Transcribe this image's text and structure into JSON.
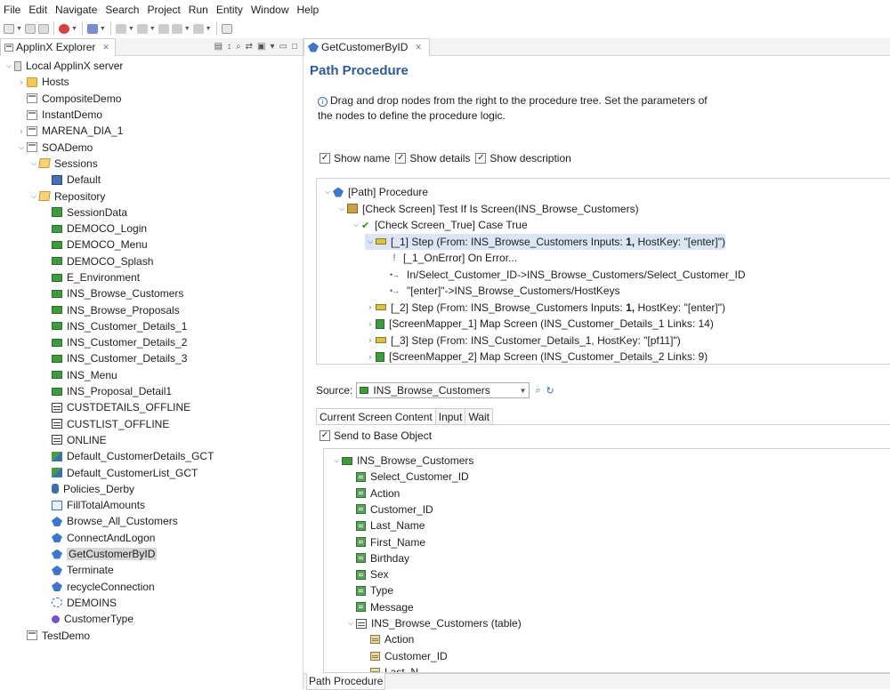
{
  "menu": [
    "File",
    "Edit",
    "Navigate",
    "Search",
    "Project",
    "Run",
    "Entity",
    "Window",
    "Help"
  ],
  "explorer": {
    "tab_label": "ApplinX Explorer",
    "tab_close": "✕",
    "tree": [
      {
        "label": "Local ApplinX server",
        "icon": "server-icon",
        "depth": 0,
        "twisty": "open"
      },
      {
        "label": "Hosts",
        "icon": "folder-icon",
        "depth": 1,
        "twisty": "closed"
      },
      {
        "label": "CompositeDemo",
        "icon": "application-icon",
        "depth": 1,
        "twisty": ""
      },
      {
        "label": "InstantDemo",
        "icon": "application-icon",
        "depth": 1,
        "twisty": ""
      },
      {
        "label": "MARENA_DIA_1",
        "icon": "application-icon",
        "depth": 1,
        "twisty": "closed"
      },
      {
        "label": "SOADemo",
        "icon": "application-icon",
        "depth": 1,
        "twisty": "open"
      },
      {
        "label": "Sessions",
        "icon": "open-folder-icon",
        "depth": 2,
        "twisty": "open"
      },
      {
        "label": "Default",
        "icon": "session-icon",
        "depth": 3,
        "twisty": ""
      },
      {
        "label": "Repository",
        "icon": "open-folder-icon",
        "depth": 2,
        "twisty": "open"
      },
      {
        "label": "SessionData",
        "icon": "session-data-icon",
        "depth": 3,
        "twisty": ""
      },
      {
        "label": "DEMOCO_Login",
        "icon": "screen-icon",
        "depth": 3,
        "twisty": ""
      },
      {
        "label": "DEMOCO_Menu",
        "icon": "screen-icon",
        "depth": 3,
        "twisty": ""
      },
      {
        "label": "DEMOCO_Splash",
        "icon": "screen-icon",
        "depth": 3,
        "twisty": ""
      },
      {
        "label": "E_Environment",
        "icon": "screen-icon",
        "depth": 3,
        "twisty": ""
      },
      {
        "label": "INS_Browse_Customers",
        "icon": "screen-icon",
        "depth": 3,
        "twisty": ""
      },
      {
        "label": "INS_Browse_Proposals",
        "icon": "screen-icon",
        "depth": 3,
        "twisty": ""
      },
      {
        "label": "INS_Customer_Details_1",
        "icon": "screen-icon",
        "depth": 3,
        "twisty": ""
      },
      {
        "label": "INS_Customer_Details_2",
        "icon": "screen-icon",
        "depth": 3,
        "twisty": ""
      },
      {
        "label": "INS_Customer_Details_3",
        "icon": "screen-icon",
        "depth": 3,
        "twisty": ""
      },
      {
        "label": "INS_Menu",
        "icon": "screen-icon",
        "depth": 3,
        "twisty": ""
      },
      {
        "label": "INS_Proposal_Detail1",
        "icon": "screen-icon",
        "depth": 3,
        "twisty": ""
      },
      {
        "label": "CUSTDETAILS_OFFLINE",
        "icon": "table-icon",
        "depth": 3,
        "twisty": ""
      },
      {
        "label": "CUSTLIST_OFFLINE",
        "icon": "table-icon",
        "depth": 3,
        "twisty": ""
      },
      {
        "label": "ONLINE",
        "icon": "table-icon",
        "depth": 3,
        "twisty": ""
      },
      {
        "label": "Default_CustomerDetails_GCT",
        "icon": "gct-icon",
        "depth": 3,
        "twisty": ""
      },
      {
        "label": "Default_CustomerList_GCT",
        "icon": "gct-icon",
        "depth": 3,
        "twisty": ""
      },
      {
        "label": "Policies_Derby",
        "icon": "database-icon",
        "depth": 3,
        "twisty": ""
      },
      {
        "label": "FillTotalAmounts",
        "icon": "flow-icon",
        "depth": 3,
        "twisty": ""
      },
      {
        "label": "Browse_All_Customers",
        "icon": "path-procedure-icon",
        "depth": 3,
        "twisty": ""
      },
      {
        "label": "ConnectAndLogon",
        "icon": "path-procedure-icon",
        "depth": 3,
        "twisty": ""
      },
      {
        "label": "GetCustomerByID",
        "icon": "path-procedure-icon",
        "depth": 3,
        "twisty": "",
        "selected": true
      },
      {
        "label": "Terminate",
        "icon": "path-procedure-icon",
        "depth": 3,
        "twisty": ""
      },
      {
        "label": "recycleConnection",
        "icon": "path-procedure-icon",
        "depth": 3,
        "twisty": ""
      },
      {
        "label": "DEMOINS",
        "icon": "demoins-icon",
        "depth": 3,
        "twisty": ""
      },
      {
        "label": "CustomerType",
        "icon": "type-icon",
        "depth": 3,
        "twisty": ""
      },
      {
        "label": "TestDemo",
        "icon": "application-icon",
        "depth": 1,
        "twisty": ""
      }
    ]
  },
  "editor": {
    "tab_label": "GetCustomerByID",
    "tab_close": "✕",
    "title": "Path Procedure",
    "info_line1": "Drag and drop nodes from the right to the procedure tree. Set the parameters of",
    "info_line2": "the nodes to define the procedure logic.",
    "show_name": "Show name",
    "show_details": "Show details",
    "show_description": "Show description",
    "procedure_tree": [
      {
        "label": "[Path] Procedure",
        "icon": "path-icon",
        "twisty": "open",
        "depth": 0
      },
      {
        "label": "[Check Screen] Test If Is Screen(INS_Browse_Customers)",
        "icon": "check-screen-icon",
        "twisty": "open",
        "depth": 1
      },
      {
        "label": "[Check Screen_True] Case True",
        "icon": "case-true-icon",
        "twisty": "open",
        "depth": 2
      },
      {
        "label_pre": "[_1] Step (From: INS_Browse_Customers Inputs: ",
        "label_bold": "1,",
        "label_post": " HostKey: \"[enter]\")",
        "icon": "step-icon",
        "twisty": "open",
        "depth": 3,
        "highlight": true
      },
      {
        "label": "[_1_OnError] On Error...",
        "icon": "error-icon",
        "twisty": "",
        "depth": 4
      },
      {
        "label": "In/Select_Customer_ID->INS_Browse_Customers/Select_Customer_ID",
        "icon": "link-icon",
        "twisty": "",
        "depth": 4
      },
      {
        "label": "\"[enter]\"->INS_Browse_Customers/HostKeys",
        "icon": "link-icon",
        "twisty": "",
        "depth": 4
      },
      {
        "label_pre": "[_2] Step (From: INS_Browse_Customers Inputs: ",
        "label_bold": "1,",
        "label_post": " HostKey: \"[enter]\")",
        "icon": "step-icon",
        "twisty": "closed",
        "depth": 3
      },
      {
        "label": "[ScreenMapper_1] Map Screen (INS_Customer_Details_1 Links: 14)",
        "icon": "map-screen-icon",
        "twisty": "closed",
        "depth": 3
      },
      {
        "label": "[_3] Step (From: INS_Customer_Details_1, HostKey: \"[pf11]\")",
        "icon": "step-icon",
        "twisty": "closed",
        "depth": 3
      },
      {
        "label": "[ScreenMapper_2] Map Screen (INS_Customer_Details_2 Links: 9)",
        "icon": "map-screen-icon",
        "twisty": "closed",
        "depth": 3
      }
    ],
    "source_label": "Source:",
    "source_value": "INS_Browse_Customers",
    "subtabs": [
      "Current Screen Content",
      "Input",
      "Wait"
    ],
    "send_to_base": "Send to Base Object",
    "screen_tree": [
      {
        "label": "INS_Browse_Customers",
        "icon": "screen-icon",
        "twisty": "open",
        "depth": 0
      },
      {
        "label": "Select_Customer_ID",
        "icon": "field-icon",
        "twisty": "",
        "depth": 1
      },
      {
        "label": "Action",
        "icon": "field-icon",
        "twisty": "",
        "depth": 1
      },
      {
        "label": "Customer_ID",
        "icon": "field-icon",
        "twisty": "",
        "depth": 1
      },
      {
        "label": "Last_Name",
        "icon": "field-icon",
        "twisty": "",
        "depth": 1
      },
      {
        "label": "First_Name",
        "icon": "field-icon",
        "twisty": "",
        "depth": 1
      },
      {
        "label": "Birthday",
        "icon": "field-icon",
        "twisty": "",
        "depth": 1
      },
      {
        "label": "Sex",
        "icon": "field-icon",
        "twisty": "",
        "depth": 1
      },
      {
        "label": "Type",
        "icon": "field-icon",
        "twisty": "",
        "depth": 1
      },
      {
        "label": "Message",
        "icon": "field-icon",
        "twisty": "",
        "depth": 1
      },
      {
        "label": "INS_Browse_Customers (table)",
        "icon": "table-icon",
        "twisty": "open",
        "depth": 1
      },
      {
        "label": "Action",
        "icon": "column-icon",
        "twisty": "",
        "depth": 2
      },
      {
        "label": "Customer_ID",
        "icon": "column-icon",
        "twisty": "",
        "depth": 2
      },
      {
        "label": "Last_N",
        "icon": "column-icon",
        "twisty": "",
        "depth": 2
      }
    ],
    "bottom_tab": "Path Procedure"
  },
  "colors": {
    "title_blue": "#2e5b95",
    "selection_gray": "#d7d7d7",
    "highlight_blue": "#dbe5f4"
  }
}
